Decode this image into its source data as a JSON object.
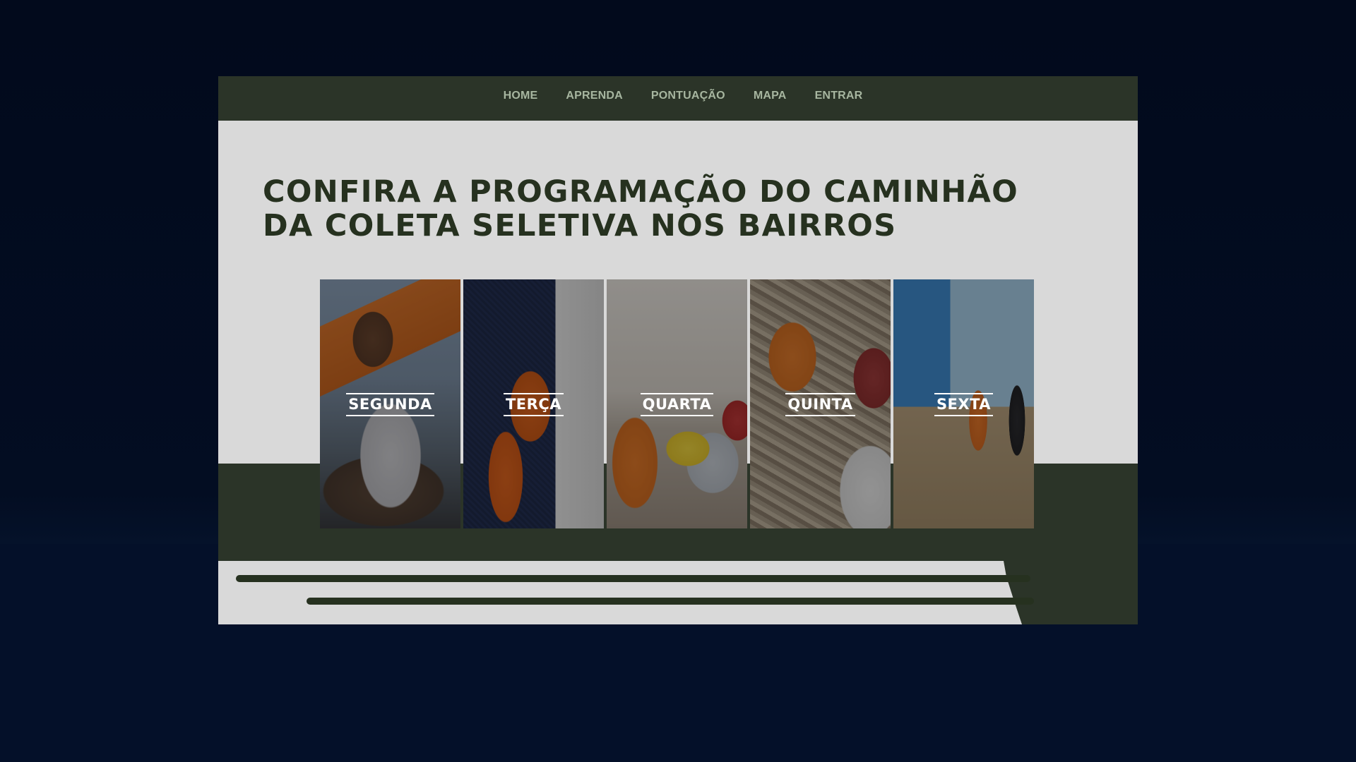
{
  "nav": {
    "items": [
      {
        "label": "HOME"
      },
      {
        "label": "APRENDA"
      },
      {
        "label": "PONTUAÇÃO"
      },
      {
        "label": "MAPA"
      },
      {
        "label": "ENTRAR"
      }
    ]
  },
  "hero": {
    "title_line1": "CONFIRA A PROGRAMAÇÃO DO CAMINHÃO",
    "title_line2": "DA COLETA SELETIVA NOS BAIRROS"
  },
  "schedule": {
    "days": [
      {
        "label": "SEGUNDA"
      },
      {
        "label": "TERÇA"
      },
      {
        "label": "QUARTA"
      },
      {
        "label": "QUINTA"
      },
      {
        "label": "SEXTA"
      }
    ]
  },
  "colors": {
    "background": "#030d22",
    "page": "#d9d9d9",
    "accent_dark_green": "#2b3428",
    "nav_text": "#a7b6a0",
    "headline": "#26311f"
  }
}
